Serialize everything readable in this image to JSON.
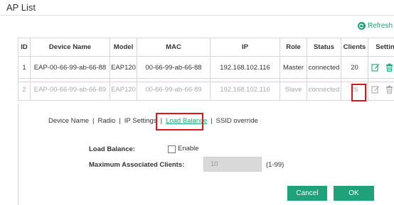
{
  "page": {
    "title": "AP List",
    "refresh_label": "Refresh"
  },
  "table": {
    "headers": [
      "ID",
      "Device Name",
      "Model",
      "MAC",
      "IP",
      "Role",
      "Status",
      "Clients",
      "Settings"
    ],
    "rows": [
      {
        "id": "1",
        "device_name": "EAP-00-66-99-ab-66-88",
        "model": "EAP120",
        "mac": "00-66-99-ab-66-88",
        "ip": "192.168.102.116",
        "role": "Master",
        "status": "connected",
        "clients": "20"
      },
      {
        "id": "2",
        "device_name": "EAP-00-66-99-ab-66-89",
        "model": "EAP120",
        "mac": "00-66-99-ab-66-89",
        "ip": "192.168.102.116",
        "role": "Slave",
        "status": "connected",
        "clients": "26"
      }
    ]
  },
  "tabs": {
    "device_name": "Device Name",
    "radio": "Radio",
    "ip_settings": "IP Settings",
    "load_balance": "Load Balance",
    "ssid_override": "SSID override",
    "separator": "|"
  },
  "form": {
    "load_balance_label": "Load Balance:",
    "enable_label": "Enable",
    "max_clients_label": "Maximum Associated Clients:",
    "max_clients_value": "10",
    "max_clients_range": "(1-99)"
  },
  "buttons": {
    "cancel": "Cancel",
    "ok": "OK"
  },
  "colors": {
    "accent": "#1fa27a",
    "highlight": "#e0151c",
    "disabled_text": "#aaaaaa"
  }
}
